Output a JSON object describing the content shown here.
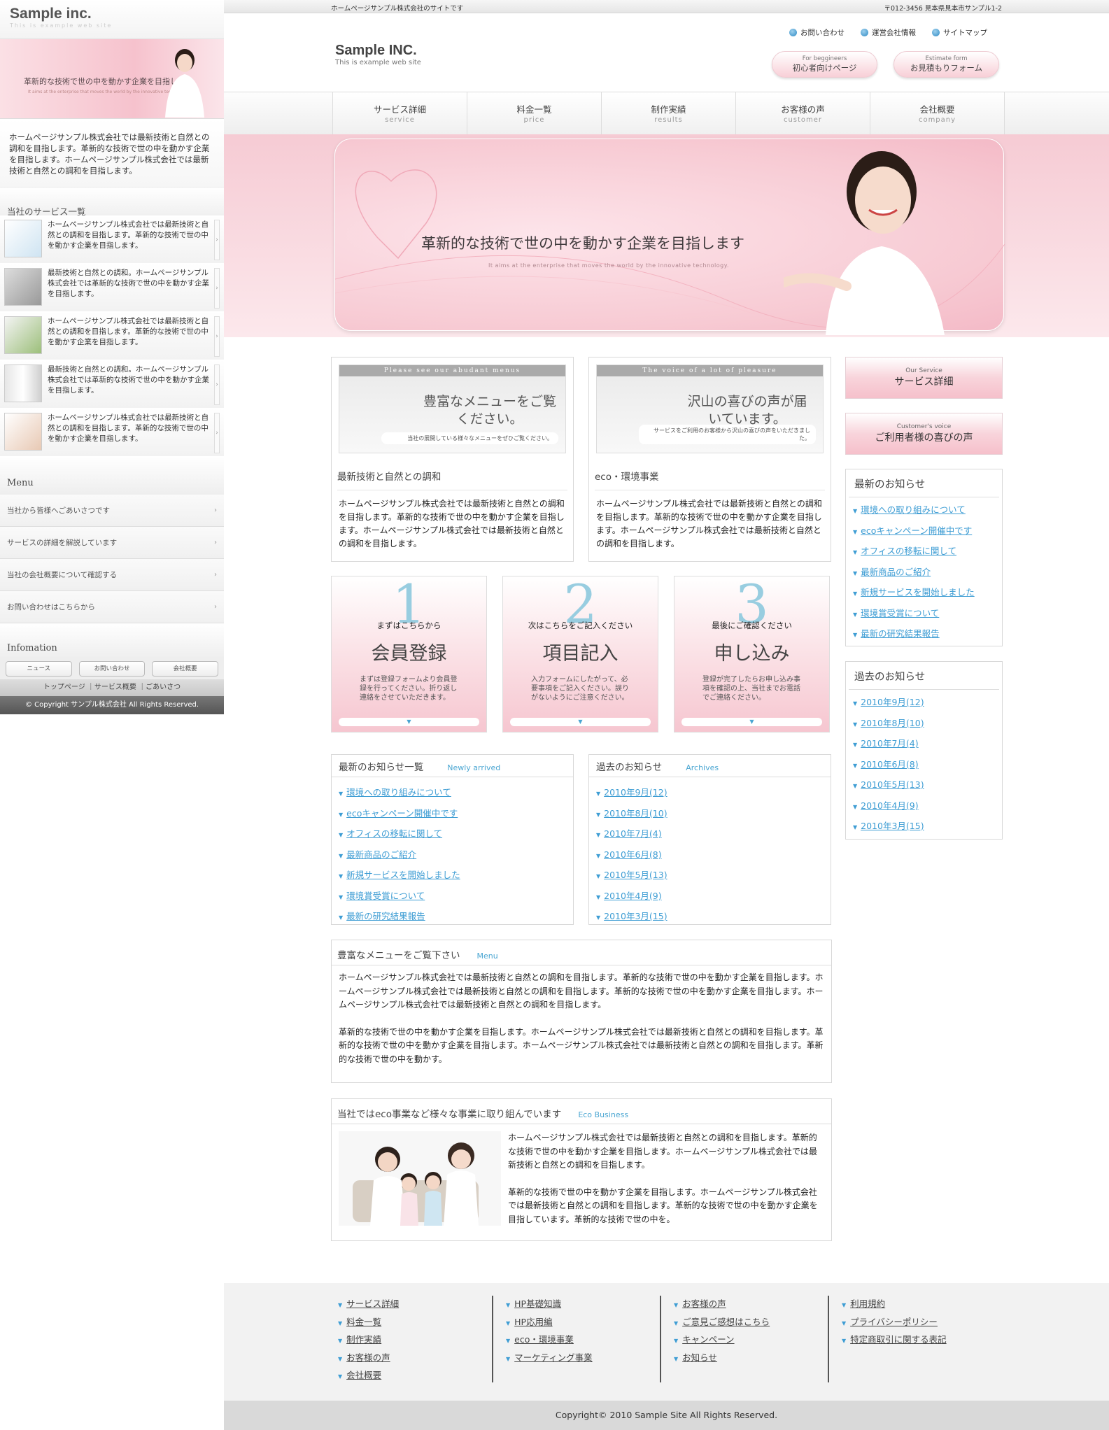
{
  "left": {
    "logo": "Sample inc.",
    "logo_sub": "This is example web site",
    "banner_caption": "革新的な技術で世の中を動かす企業を目指します",
    "banner_sub": "It aims at the enterprise that moves the world by the innovative technology.",
    "intro": "ホームページサンプル株式会社では最新技術と自然との調和を目指します。革新的な技術で世の中を動かす企業を目指します。ホームページサンプル株式会社では最新技術と自然との調和を目指します。",
    "services_title": "当社のサービス一覧",
    "services": [
      "ホームページサンプル株式会社では最新技術と自然との調和を目指します。革新的な技術で世の中を動かす企業を目指します。",
      "最新技術と自然との調和。ホームページサンプル株式会社では革新的な技術で世の中を動かす企業を目指します。",
      "ホームページサンプル株式会社では最新技術と自然との調和を目指します。革新的な技術で世の中を動かす企業を目指します。",
      "最新技術と自然との調和。ホームページサンプル株式会社では革新的な技術で世の中を動かす企業を目指します。",
      "ホームページサンプル株式会社では最新技術と自然との調和を目指します。革新的な技術で世の中を動かす企業を目指します。"
    ],
    "menu_title": "Menu",
    "menu": [
      "当社から皆様へごあいさつです",
      "サービスの詳細を解説しています",
      "当社の会社概要について確認する",
      "お問い合わせはこちらから"
    ],
    "info_title": "Infomation",
    "info_buttons": [
      "ニュース",
      "お問い合わせ",
      "会社概要"
    ],
    "footer_links": "トップページ ｜サービス概要 ｜ごあいさつ",
    "copyright": "© Copyright サンプル株式会社 All Rights Reserved."
  },
  "top": {
    "tagline": "ホームページサンプル株式会社のサイトです",
    "address": "〒012-3456 見本県見本市サンプル1-2"
  },
  "header": {
    "brand": "Sample INC.",
    "brand_sub": "This is example web site",
    "links": [
      "お問い合わせ",
      "運営会社情報",
      "サイトマップ"
    ],
    "btn1_en": "For beggineers",
    "btn1_ja": "初心者向けページ",
    "btn2_en": "Estimate form",
    "btn2_ja": "お見積もりフォーム"
  },
  "nav": [
    {
      "ja": "サービス詳細",
      "en": "service"
    },
    {
      "ja": "料金一覧",
      "en": "price"
    },
    {
      "ja": "制作実績",
      "en": "results"
    },
    {
      "ja": "お客様の声",
      "en": "customer"
    },
    {
      "ja": "会社概要",
      "en": "company"
    }
  ],
  "hero": {
    "caption": "革新的な技術で世の中を動かす企業を目指します",
    "sub": "It aims at the enterprise that moves the world by the innovative technology."
  },
  "menu_panels": [
    {
      "band": "Please see our abudant menus",
      "big": "豊富なメニューをご覧ください。",
      "small": "当社の展開している様々なメニューをぜひご覧ください。",
      "title": "最新技術と自然との調和",
      "text": "ホームページサンプル株式会社では最新技術と自然との調和を目指します。革新的な技術で世の中を動かす企業を目指します。ホームページサンプル株式会社では最新技術と自然との調和を目指します。"
    },
    {
      "band": "The voice of a lot of pleasure",
      "big": "沢山の喜びの声が届いています。",
      "small": "サービスをご利用のお客様から沢山の喜びの声をいただきました。",
      "title": "eco・環境事業",
      "text": "ホームページサンプル株式会社では最新技術と自然との調和を目指します。革新的な技術で世の中を動かす企業を目指します。ホームページサンプル株式会社では最新技術と自然との調和を目指します。"
    }
  ],
  "steps": [
    {
      "num": "1",
      "head": "まずはこちらから",
      "big": "会員登録",
      "desc": "まずは登録フォームより会員登録を行ってください。折り返し連絡をさせていただきます。"
    },
    {
      "num": "2",
      "head": "次はこちらをご記入ください",
      "big": "項目記入",
      "desc": "入力フォームにしたがって、必要事項をご記入ください。誤りがないようにご注意ください。"
    },
    {
      "num": "3",
      "head": "最後にご確認ください",
      "big": "申し込み",
      "desc": "登録が完了したらお申し込み事項を確認の上、当社までお電話でご連絡ください。"
    }
  ],
  "news": {
    "title": "最新のお知らせ一覧",
    "title_en": "Newly arrived",
    "items": [
      "環境への取り組みについて",
      "ecoキャンペーン開催中です",
      "オフィスの移転に関して",
      "最新商品のご紹介",
      "新規サービスを開始しました",
      "環境賞受賞について",
      "最新の研究結果報告"
    ]
  },
  "archives": {
    "title": "過去のお知らせ",
    "title_en": "Archives",
    "items": [
      "2010年9月(12)",
      "2010年8月(10)",
      "2010年7月(4)",
      "2010年6月(8)",
      "2010年5月(13)",
      "2010年4月(9)",
      "2010年3月(15)"
    ]
  },
  "menu_section": {
    "title": "豊富なメニューをご覧下さい",
    "title_en": "Menu",
    "p1": "ホームページサンプル株式会社では最新技術と自然との調和を目指します。革新的な技術で世の中を動かす企業を目指します。ホームページサンプル株式会社では最新技術と自然との調和を目指します。革新的な技術で世の中を動かす企業を目指します。ホームページサンプル株式会社では最新技術と自然との調和を目指します。",
    "p2": "革新的な技術で世の中を動かす企業を目指します。ホームページサンプル株式会社では最新技術と自然との調和を目指します。革新的な技術で世の中を動かす企業を目指します。ホームページサンプル株式会社では最新技術と自然との調和を目指します。革新的な技術で世の中を動かす。"
  },
  "eco_section": {
    "title": "当社ではeco事業など様々な事業に取り組んでいます",
    "title_en": "Eco Business",
    "p1": "ホームページサンプル株式会社では最新技術と自然との調和を目指します。革新的な技術で世の中を動かす企業を目指します。ホームページサンプル株式会社では最新技術と自然との調和を目指します。",
    "p2": "革新的な技術で世の中を動かす企業を目指します。ホームページサンプル株式会社では最新技術と自然との調和を目指します。革新的な技術で世の中を動かす企業を目指しています。革新的な技術で世の中を。"
  },
  "side": {
    "btn1_en": "Our Service",
    "btn1_ja": "サービス詳細",
    "btn2_en": "Customer's voice",
    "btn2_ja": "ご利用者様の喜びの声",
    "news_title": "最新のお知らせ",
    "news": [
      "環境への取り組みについて",
      "ecoキャンペーン開催中です",
      "オフィスの移転に関して",
      "最新商品のご紹介",
      "新規サービスを開始しました",
      "環境賞受賞について",
      "最新の研究結果報告"
    ],
    "archive_title": "過去のお知らせ",
    "archives": [
      "2010年9月(12)",
      "2010年8月(10)",
      "2010年7月(4)",
      "2010年6月(8)",
      "2010年5月(13)",
      "2010年4月(9)",
      "2010年3月(15)"
    ]
  },
  "footer": {
    "col1": [
      "サービス詳細",
      "料金一覧",
      "制作実績",
      "お客様の声",
      "会社概要"
    ],
    "col2": [
      "HP基礎知識",
      "HP応用編",
      "eco・環境事業",
      "マーケティング事業"
    ],
    "col3": [
      "お客様の声",
      "ご意見ご感想はこちら",
      "キャンペーン",
      "お知らせ"
    ],
    "col4": [
      "利用規約",
      "プライバシーポリシー",
      "特定商取引に関する表記"
    ],
    "copyright": "Copyright© 2010 Sample Site All Rights Reserved."
  }
}
